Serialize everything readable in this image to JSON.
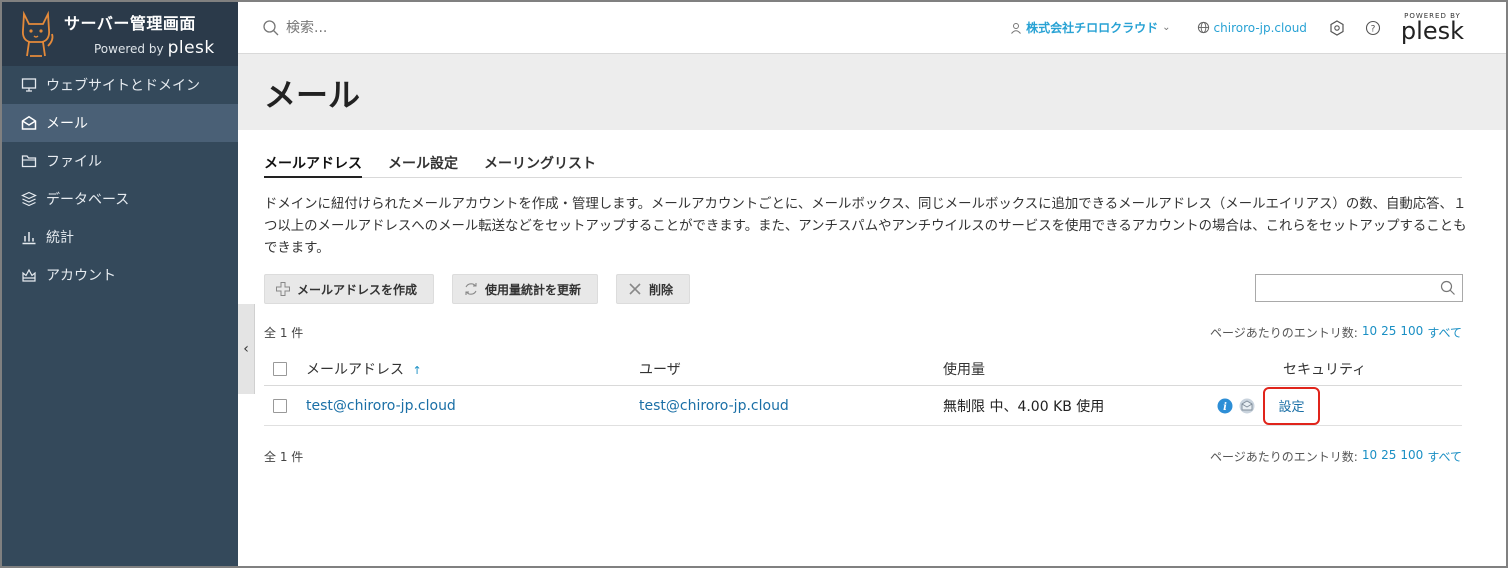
{
  "brand": {
    "title": "サーバー管理画面",
    "powered_by": "Powered by",
    "plesk": "plesk"
  },
  "sidebar": {
    "items": [
      {
        "label": "ウェブサイトとドメイン",
        "icon": "monitor-icon",
        "active": false
      },
      {
        "label": "メール",
        "icon": "mail-icon",
        "active": true
      },
      {
        "label": "ファイル",
        "icon": "folder-icon",
        "active": false
      },
      {
        "label": "データベース",
        "icon": "database-icon",
        "active": false
      },
      {
        "label": "統計",
        "icon": "stats-icon",
        "active": false
      },
      {
        "label": "アカウント",
        "icon": "account-icon",
        "active": false
      }
    ],
    "collapse_label": "‹"
  },
  "topbar": {
    "search_placeholder": "検索...",
    "account_label": "株式会社チロロクラウド",
    "domain_label": "chiroro-jp.cloud",
    "powered_by": "POWERED BY",
    "plesk": "plesk"
  },
  "page": {
    "title": "メール"
  },
  "tabs": [
    {
      "label": "メールアドレス",
      "active": true
    },
    {
      "label": "メール設定",
      "active": false
    },
    {
      "label": "メーリングリスト",
      "active": false
    }
  ],
  "description": "ドメインに紐付けられたメールアカウントを作成・管理します。メールアカウントごとに、メールボックス、同じメールボックスに追加できるメールアドレス（メールエイリアス）の数、自動応答、１つ以上のメールアドレスへのメール転送などをセットアップすることができます。また、アンチスパムやアンチウイルスのサービスを使用できるアカウントの場合は、これらをセットアップすることもできます。",
  "toolbar": {
    "create_label": "メールアドレスを作成",
    "refresh_label": "使用量統計を更新",
    "delete_label": "削除"
  },
  "list": {
    "total_label": "全 1 件",
    "per_page_label": "ページあたりのエントリ数:",
    "per_page_options": [
      "10",
      "25",
      "100",
      "すべて"
    ],
    "columns": {
      "email": "メールアドレス",
      "sort_indicator": "↑",
      "user": "ユーザ",
      "usage": "使用量",
      "security": "セキュリティ"
    },
    "rows": [
      {
        "email": "test@chiroro-jp.cloud",
        "user": "test@chiroro-jp.cloud",
        "usage": "無制限 中、4.00 KB 使用",
        "settings_label": "設定"
      }
    ]
  },
  "colors": {
    "sidebar_bg": "#34495b",
    "sidebar_active": "#4a6076",
    "link": "#1a6fa6",
    "accent": "#28a2d4",
    "highlight": "#e0241b"
  }
}
